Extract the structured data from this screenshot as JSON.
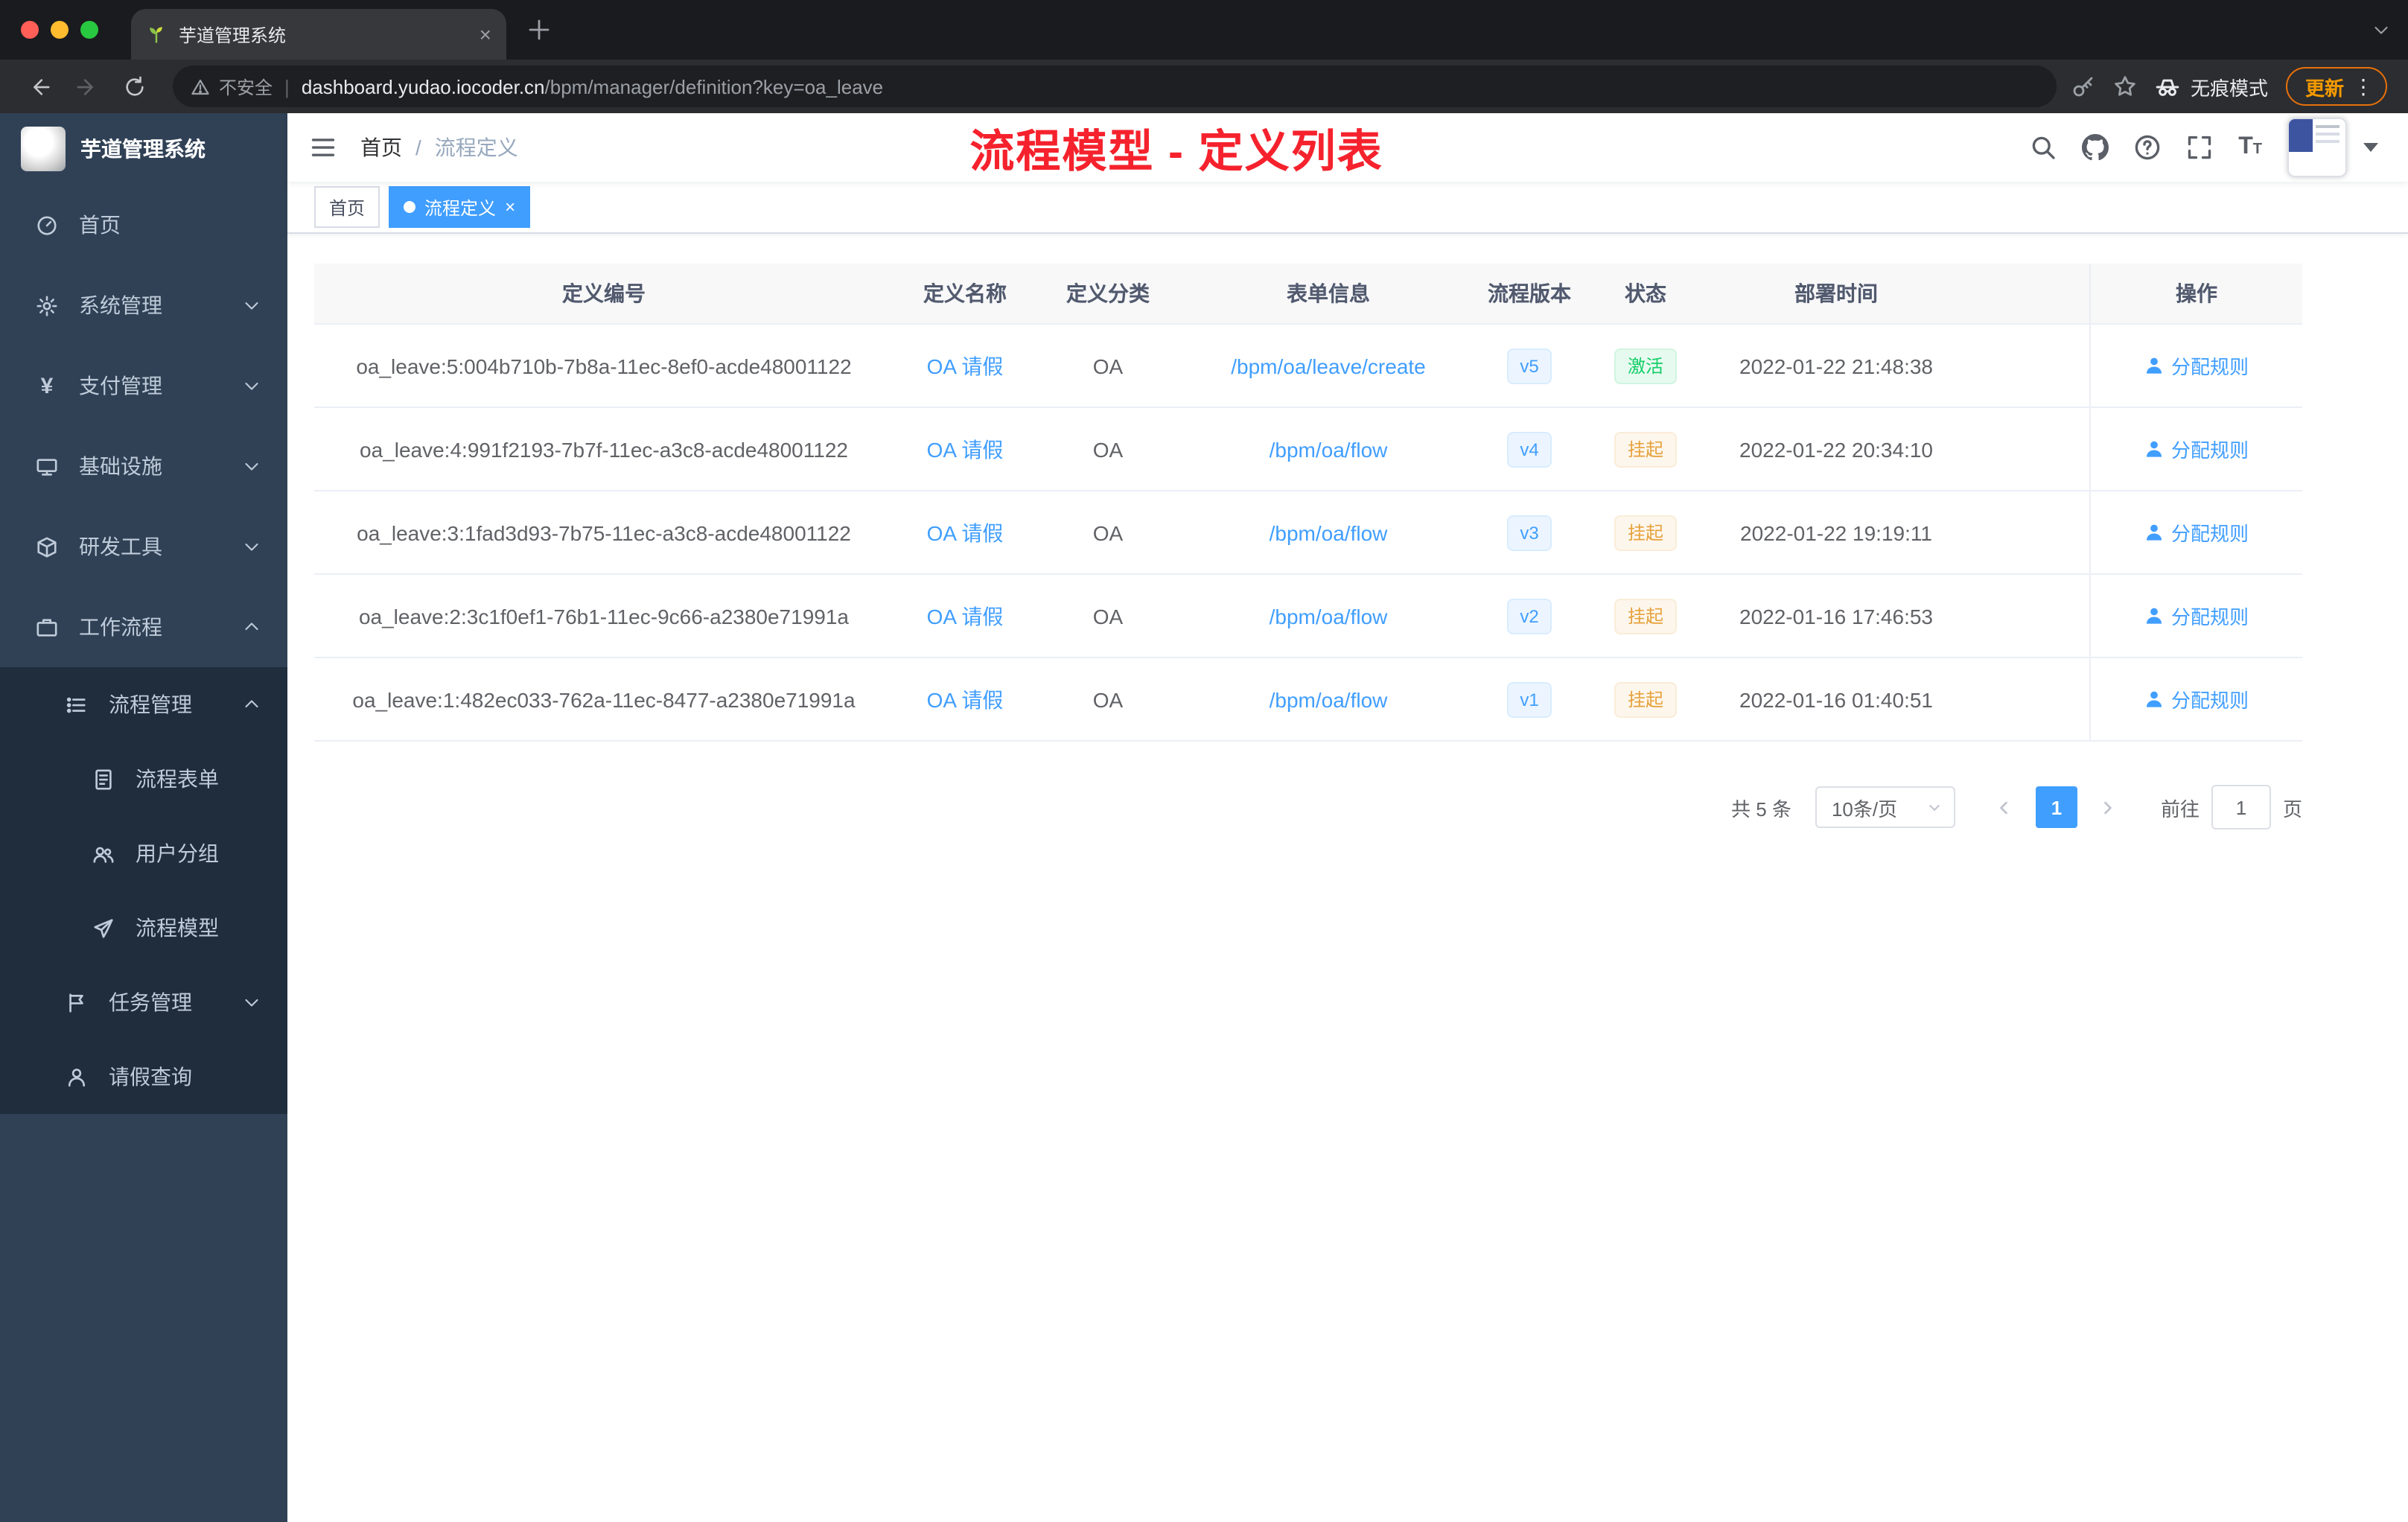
{
  "browser": {
    "tab_title": "芋道管理系统",
    "security_label": "不安全",
    "url_host": "dashboard.yudao.iocoder.cn",
    "url_path": "/bpm/manager/definition?key=oa_leave",
    "incognito_label": "无痕模式",
    "update_label": "更新"
  },
  "sidebar": {
    "logo_title": "芋道管理系统",
    "items": [
      {
        "label": "首页",
        "icon": "dashboard"
      },
      {
        "label": "系统管理",
        "icon": "gear"
      },
      {
        "label": "支付管理",
        "icon": "yen"
      },
      {
        "label": "基础设施",
        "icon": "infrastructure"
      },
      {
        "label": "研发工具",
        "icon": "toolbox"
      },
      {
        "label": "工作流程",
        "icon": "briefcase"
      },
      {
        "label": "流程管理",
        "icon": "list"
      },
      {
        "label": "流程表单",
        "icon": "form"
      },
      {
        "label": "用户分组",
        "icon": "user-group"
      },
      {
        "label": "流程模型",
        "icon": "paper-plane"
      },
      {
        "label": "任务管理",
        "icon": "flag"
      },
      {
        "label": "请假查询",
        "icon": "user"
      }
    ]
  },
  "header": {
    "breadcrumb_home": "首页",
    "breadcrumb_sep": "/",
    "breadcrumb_current": "流程定义",
    "annotation": "流程模型 - 定义列表"
  },
  "tags": {
    "home": "首页",
    "active": "流程定义"
  },
  "table": {
    "columns": [
      "定义编号",
      "定义名称",
      "定义分类",
      "表单信息",
      "流程版本",
      "状态",
      "部署时间",
      "操作"
    ],
    "rows": [
      {
        "id": "oa_leave:5:004b710b-7b8a-11ec-8ef0-acde48001122",
        "name": "OA 请假",
        "category": "OA",
        "form": "/bpm/oa/leave/create",
        "version": "v5",
        "status": "激活",
        "time": "2022-01-22 21:48:38",
        "action": "分配规则"
      },
      {
        "id": "oa_leave:4:991f2193-7b7f-11ec-a3c8-acde48001122",
        "name": "OA 请假",
        "category": "OA",
        "form": "/bpm/oa/flow",
        "version": "v4",
        "status": "挂起",
        "time": "2022-01-22 20:34:10",
        "action": "分配规则"
      },
      {
        "id": "oa_leave:3:1fad3d93-7b75-11ec-a3c8-acde48001122",
        "name": "OA 请假",
        "category": "OA",
        "form": "/bpm/oa/flow",
        "version": "v3",
        "status": "挂起",
        "time": "2022-01-22 19:19:11",
        "action": "分配规则"
      },
      {
        "id": "oa_leave:2:3c1f0ef1-76b1-11ec-9c66-a2380e71991a",
        "name": "OA 请假",
        "category": "OA",
        "form": "/bpm/oa/flow",
        "version": "v2",
        "status": "挂起",
        "time": "2022-01-16 17:46:53",
        "action": "分配规则"
      },
      {
        "id": "oa_leave:1:482ec033-762a-11ec-8477-a2380e71991a",
        "name": "OA 请假",
        "category": "OA",
        "form": "/bpm/oa/flow",
        "version": "v1",
        "status": "挂起",
        "time": "2022-01-16 01:40:51",
        "action": "分配规则"
      }
    ]
  },
  "pagination": {
    "total": "共 5 条",
    "page_size": "10条/页",
    "current": "1",
    "goto_label": "前往",
    "goto_value": "1",
    "page_label": "页"
  },
  "colors": {
    "accent": "#409eff",
    "status_active": "#13ce66",
    "status_suspended": "#e6a23c",
    "sidebar_bg": "#304156",
    "submenu_bg": "#1f2d3d",
    "annotation_red": "#f5222d"
  }
}
